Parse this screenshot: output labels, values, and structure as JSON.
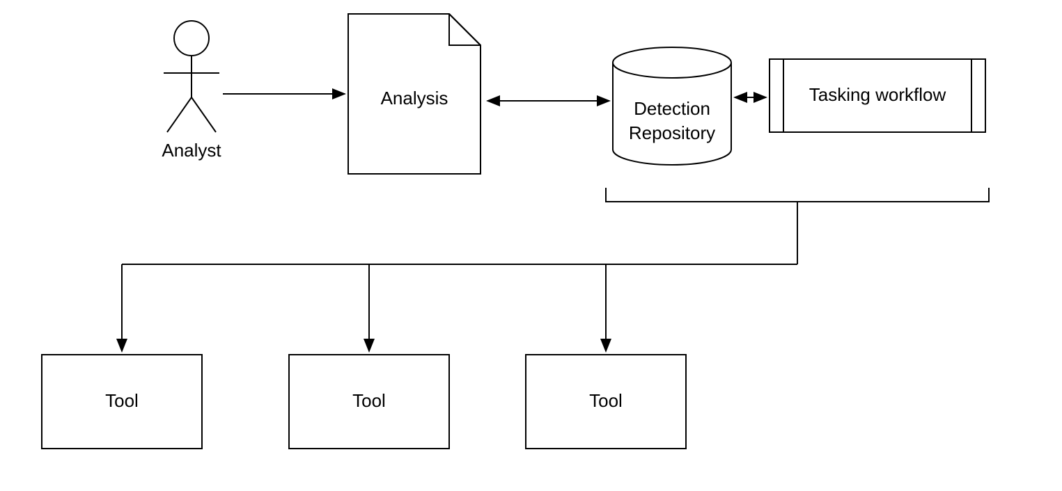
{
  "nodes": {
    "analyst": "Analyst",
    "analysis": "Analysis",
    "detection_repository_line1": "Detection",
    "detection_repository_line2": "Repository",
    "tasking_workflow": "Tasking workflow",
    "tool1": "Tool",
    "tool2": "Tool",
    "tool3": "Tool"
  }
}
